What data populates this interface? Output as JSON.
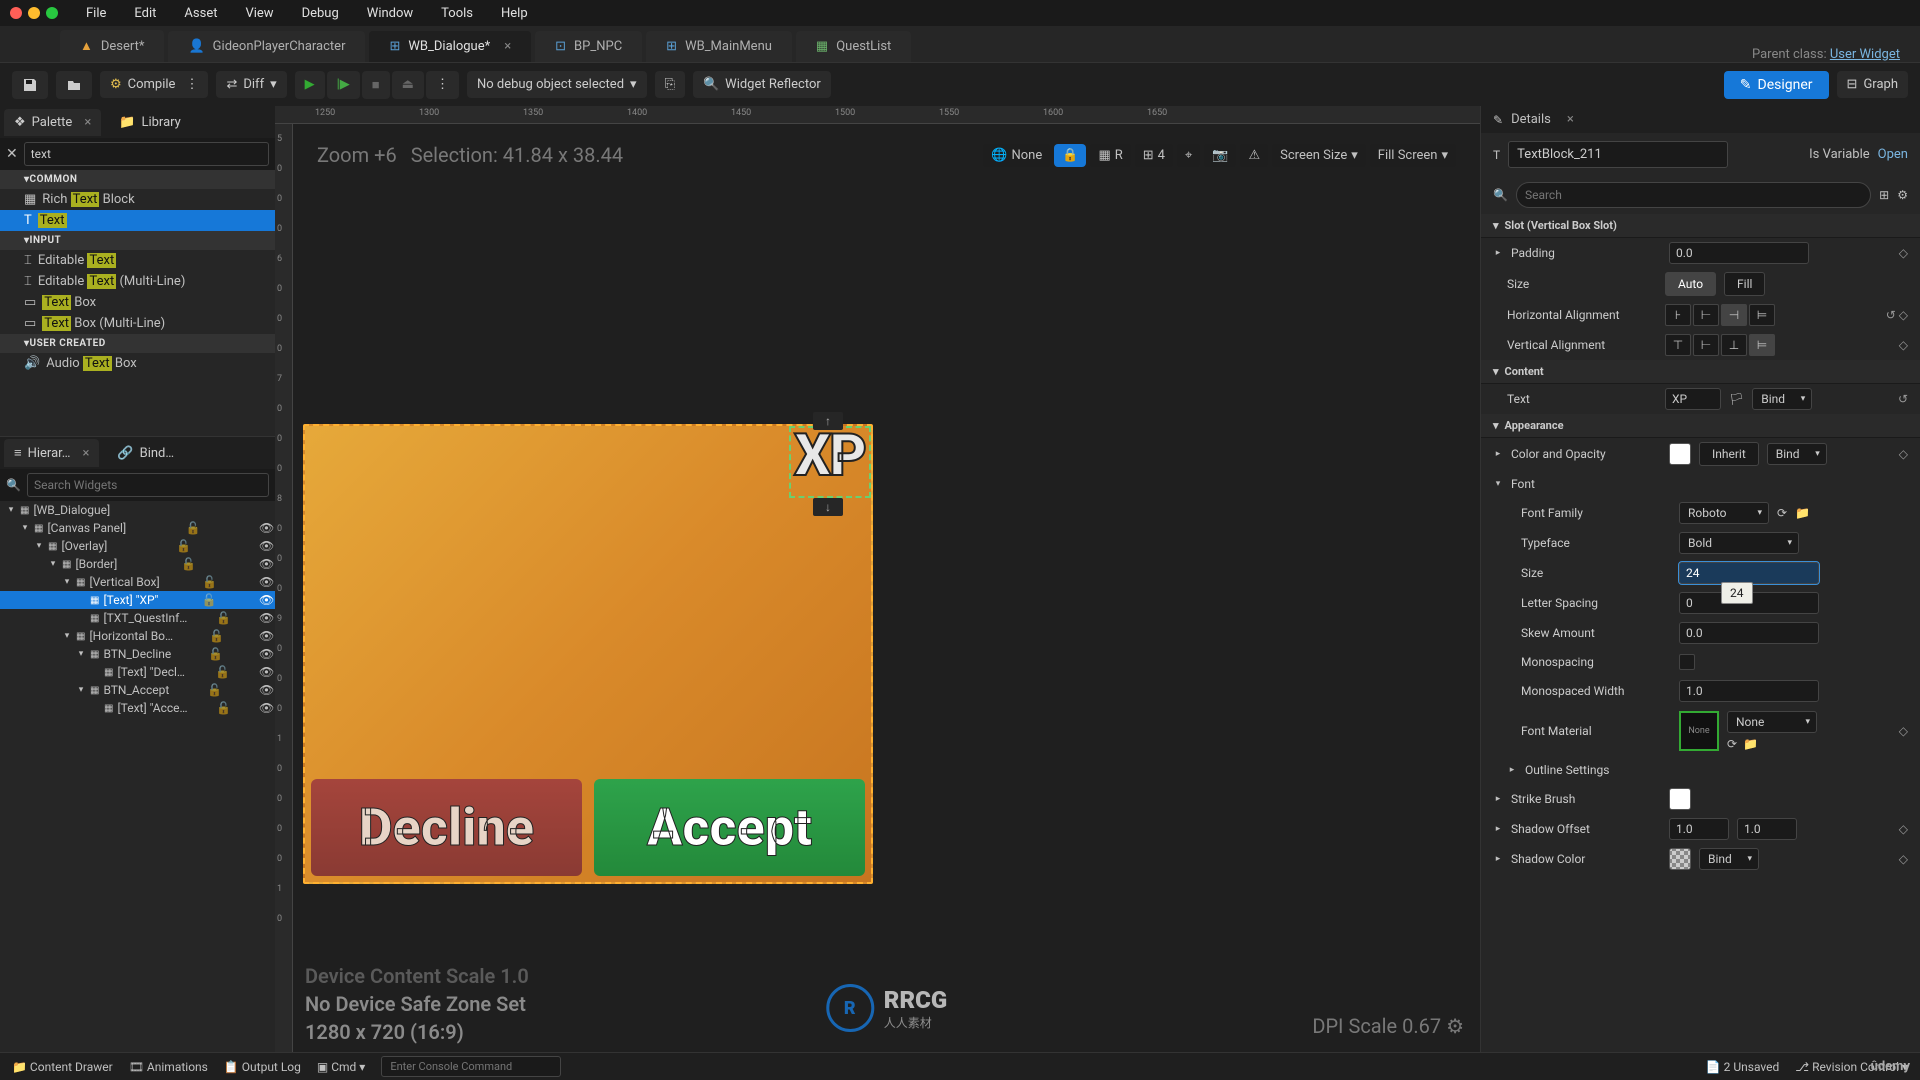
{
  "menubar": [
    "File",
    "Edit",
    "Asset",
    "View",
    "Debug",
    "Window",
    "Tools",
    "Help"
  ],
  "tabs": [
    {
      "label": "Desert*",
      "icon": "level"
    },
    {
      "label": "GideonPlayerCharacter",
      "icon": "bp"
    },
    {
      "label": "WB_Dialogue*",
      "icon": "widget",
      "active": true,
      "closeable": true
    },
    {
      "label": "BP_NPC",
      "icon": "bp"
    },
    {
      "label": "WB_MainMenu",
      "icon": "widget"
    },
    {
      "label": "QuestList",
      "icon": "data"
    }
  ],
  "parent_class": {
    "label": "Parent class:",
    "value": "User Widget"
  },
  "toolbar": {
    "compile": "Compile",
    "diff": "Diff",
    "no_debug": "No debug object selected",
    "reflector": "Widget Reflector",
    "designer": "Designer",
    "graph": "Graph"
  },
  "palette": {
    "tab1": "Palette",
    "tab2": "Library",
    "search": "text",
    "sections": [
      {
        "title": "COMMON",
        "items": [
          {
            "pre": "Rich ",
            "hl": "Text",
            "post": " Block"
          },
          {
            "pre": "",
            "hl": "Text",
            "post": "",
            "selected": true
          }
        ]
      },
      {
        "title": "INPUT",
        "items": [
          {
            "pre": "Editable ",
            "hl": "Text",
            "post": ""
          },
          {
            "pre": "Editable ",
            "hl": "Text",
            "post": " (Multi-Line)"
          },
          {
            "pre": "",
            "hl": "Text",
            "post": " Box"
          },
          {
            "pre": "",
            "hl": "Text",
            "post": " Box (Multi-Line)"
          }
        ]
      },
      {
        "title": "USER CREATED",
        "items": [
          {
            "pre": "Audio ",
            "hl": "Text",
            "post": " Box"
          }
        ]
      }
    ]
  },
  "hierarchy": {
    "tab1": "Hierar…",
    "tab2": "Bind…",
    "search_ph": "Search Widgets",
    "tree": [
      {
        "d": 0,
        "arr": "▾",
        "label": "[WB_Dialogue]"
      },
      {
        "d": 1,
        "arr": "▾",
        "label": "[Canvas Panel]",
        "vis": true
      },
      {
        "d": 2,
        "arr": "▾",
        "label": "[Overlay]",
        "vis": true
      },
      {
        "d": 3,
        "arr": "▾",
        "label": "[Border]",
        "vis": true
      },
      {
        "d": 4,
        "arr": "▾",
        "label": "[Vertical Box]",
        "vis": true
      },
      {
        "d": 5,
        "arr": "",
        "label": "[Text] \"XP\"",
        "vis": true,
        "selected": true
      },
      {
        "d": 5,
        "arr": "",
        "label": "[TXT_QuestInf…",
        "vis": true
      },
      {
        "d": 4,
        "arr": "▾",
        "label": "[Horizontal Bo…",
        "vis": true
      },
      {
        "d": 5,
        "arr": "▾",
        "label": "BTN_Decline",
        "vis": true
      },
      {
        "d": 6,
        "arr": "",
        "label": "[Text] \"Decl…",
        "vis": true
      },
      {
        "d": 5,
        "arr": "▾",
        "label": "BTN_Accept",
        "vis": true
      },
      {
        "d": 6,
        "arr": "",
        "label": "[Text] \"Acce…",
        "vis": true
      }
    ]
  },
  "canvas": {
    "zoom": "Zoom +6",
    "selection": "Selection: 41.84 x 38.44",
    "none": "None",
    "lock": "🔒",
    "R": "R",
    "grid": "4",
    "screen": "Screen Size",
    "fill": "Fill Screen",
    "ruler_h": [
      "1250",
      "1300",
      "1350",
      "1400",
      "1450",
      "1500",
      "1550",
      "1600",
      "1650"
    ],
    "ruler_v": [
      "5",
      "0",
      "0",
      "0",
      "6",
      "0",
      "0",
      "0",
      "7",
      "0",
      "0",
      "0",
      "8",
      "0",
      "0",
      "0",
      "9",
      "0",
      "0",
      "0",
      "1",
      "0",
      "0",
      "0",
      "0",
      "1",
      "0"
    ],
    "xp": "XP",
    "decline": "Decline",
    "accept": "Accept",
    "overlay1": "Device Content Scale 1.0",
    "overlay2": "No Device Safe Zone Set",
    "overlay3": "1280 x 720 (16:9)",
    "dpi": "DPI Scale 0.67",
    "watermark": "RRCG",
    "watermark2": "人人素材"
  },
  "details": {
    "title": "Details",
    "obj_name": "TextBlock_211",
    "is_var": "Is Variable",
    "open": "Open",
    "search_ph": "Search",
    "sections": {
      "slot": "Slot (Vertical Box Slot)",
      "content": "Content",
      "appearance": "Appearance",
      "font": "Font"
    },
    "props": {
      "padding": {
        "label": "Padding",
        "value": "0.0"
      },
      "size": {
        "label": "Size",
        "auto": "Auto",
        "fill": "Fill"
      },
      "halign": {
        "label": "Horizontal Alignment"
      },
      "valign": {
        "label": "Vertical Alignment"
      },
      "text": {
        "label": "Text",
        "value": "XP",
        "bind": "Bind"
      },
      "color": {
        "label": "Color and Opacity",
        "inherit": "Inherit",
        "bind": "Bind"
      },
      "font": {
        "label": "Font"
      },
      "family": {
        "label": "Font Family",
        "value": "Roboto"
      },
      "typeface": {
        "label": "Typeface",
        "value": "Bold"
      },
      "fsize": {
        "label": "Size",
        "value": "24",
        "tooltip": "24"
      },
      "spacing": {
        "label": "Letter Spacing",
        "value": "0"
      },
      "skew": {
        "label": "Skew Amount",
        "value": "0.0"
      },
      "mono": {
        "label": "Monospacing"
      },
      "monow": {
        "label": "Monospaced Width",
        "value": "1.0"
      },
      "fmat": {
        "label": "Font Material",
        "value": "None",
        "dd": "None"
      },
      "outline": {
        "label": "Outline Settings"
      },
      "strike": {
        "label": "Strike Brush"
      },
      "shadow_off": {
        "label": "Shadow Offset",
        "v1": "1.0",
        "v2": "1.0"
      },
      "shadow_col": {
        "label": "Shadow Color",
        "bind": "Bind"
      }
    }
  },
  "bottom": {
    "content": "Content Drawer",
    "anim": "Animations",
    "output": "Output Log",
    "cmd": "Cmd",
    "console_ph": "Enter Console Command",
    "unsaved": "2 Unsaved",
    "revision": "Revision Control"
  }
}
